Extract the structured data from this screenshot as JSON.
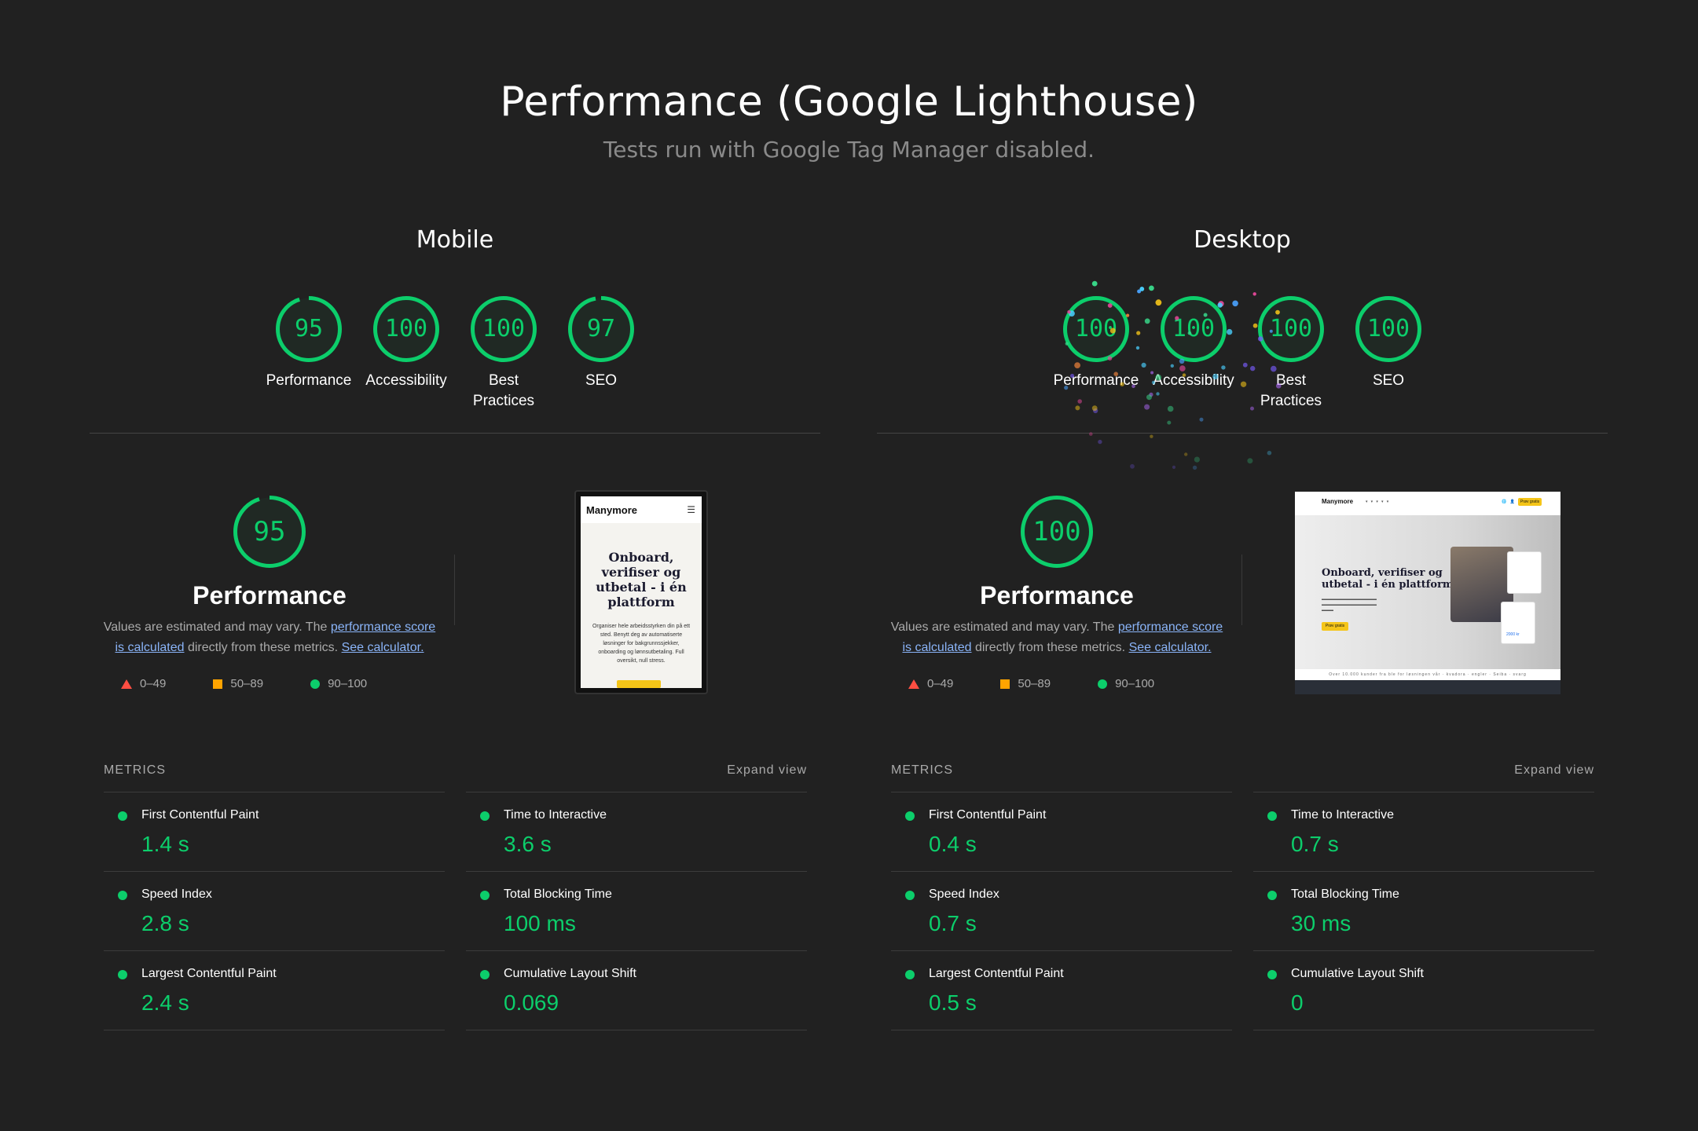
{
  "header": {
    "title": "Performance (Google Lighthouse)",
    "subtitle": "Tests run with Google Tag Manager disabled."
  },
  "colors": {
    "pass": "#0cce6b",
    "average": "#ffa400",
    "fail": "#ff4e42",
    "background": "#212121",
    "link": "#8ab4f8"
  },
  "panels": [
    {
      "title": "Mobile",
      "gauges": [
        {
          "score": "95",
          "value": 95,
          "label": "Performance"
        },
        {
          "score": "100",
          "value": 100,
          "label": "Accessibility"
        },
        {
          "score": "100",
          "value": 100,
          "label": "Best Practices"
        },
        {
          "score": "97",
          "value": 97,
          "label": "SEO"
        }
      ],
      "performance": {
        "score": "95",
        "value": 95,
        "title": "Performance",
        "desc_start": "Values are estimated and may vary. The ",
        "link_score": "performance score is calculated",
        "desc_mid": " directly from these metrics. ",
        "link_calc": "See calculator."
      },
      "legend": {
        "fail": "0–49",
        "average": "50–89",
        "pass": "90–100"
      },
      "metrics_label": "Metrics",
      "expand_label": "Expand view",
      "metrics": [
        {
          "name": "First Contentful Paint",
          "value": "1.4 s"
        },
        {
          "name": "Time to Interactive",
          "value": "3.6 s"
        },
        {
          "name": "Speed Index",
          "value": "2.8 s"
        },
        {
          "name": "Total Blocking Time",
          "value": "100 ms"
        },
        {
          "name": "Largest Contentful Paint",
          "value": "2.4 s"
        },
        {
          "name": "Cumulative Layout Shift",
          "value": "0.069"
        }
      ],
      "screenshot": {
        "logo": "Manymore",
        "headline": "Onboard, verifiser og utbetal - i én plattform",
        "body": "Organiser hele arbeidsstyrken din på ett sted. Benytt deg av automatiserte løsninger for bakgrunnssjekker, onboarding og lønnsutbetaling. Full oversikt, null stress."
      }
    },
    {
      "title": "Desktop",
      "gauges": [
        {
          "score": "100",
          "value": 100,
          "label": "Performance"
        },
        {
          "score": "100",
          "value": 100,
          "label": "Accessibility"
        },
        {
          "score": "100",
          "value": 100,
          "label": "Best Practices"
        },
        {
          "score": "100",
          "value": 100,
          "label": "SEO"
        }
      ],
      "performance": {
        "score": "100",
        "value": 100,
        "title": "Performance",
        "desc_start": "Values are estimated and may vary. The ",
        "link_score": "performance score is calculated",
        "desc_mid": " directly from these metrics. ",
        "link_calc": "See calculator."
      },
      "legend": {
        "fail": "0–49",
        "average": "50–89",
        "pass": "90–100"
      },
      "metrics_label": "Metrics",
      "expand_label": "Expand view",
      "metrics": [
        {
          "name": "First Contentful Paint",
          "value": "0.4 s"
        },
        {
          "name": "Time to Interactive",
          "value": "0.7 s"
        },
        {
          "name": "Speed Index",
          "value": "0.7 s"
        },
        {
          "name": "Total Blocking Time",
          "value": "30 ms"
        },
        {
          "name": "Largest Contentful Paint",
          "value": "0.5 s"
        },
        {
          "name": "Cumulative Layout Shift",
          "value": "0"
        }
      ],
      "screenshot": {
        "logo": "Manymore",
        "headline": "Onboard, verifiser og utbetal - i én plattform",
        "cta": "Prøv gratis",
        "amount": "2000 kr",
        "logos_strip": "Over 10.000 kunder fra ble for løsningen vår · kvadora · engler · Seiba · svarg"
      }
    }
  ]
}
